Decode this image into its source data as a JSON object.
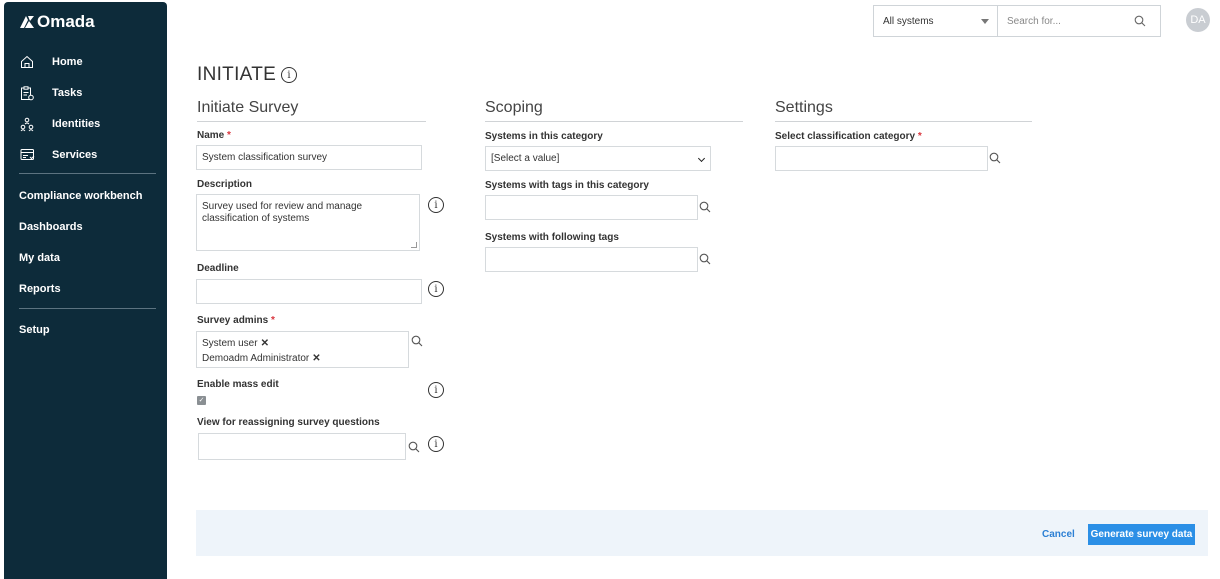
{
  "app": {
    "logo_text": "Omada"
  },
  "sidebar": {
    "items": [
      {
        "label": "Home",
        "icon": "home-icon"
      },
      {
        "label": "Tasks",
        "icon": "tasks-icon"
      },
      {
        "label": "Identities",
        "icon": "identities-icon"
      },
      {
        "label": "Services",
        "icon": "services-icon"
      }
    ],
    "links": [
      "Compliance workbench",
      "Dashboards",
      "My data",
      "Reports"
    ],
    "setup": "Setup"
  },
  "topbar": {
    "system_filter": "All systems",
    "search_placeholder": "Search for...",
    "avatar_initials": "DA"
  },
  "page": {
    "title": "INITIATE"
  },
  "initiate": {
    "heading": "Initiate Survey",
    "name_label": "Name",
    "name_value": "System classification survey",
    "description_label": "Description",
    "description_value": "Survey used for review and manage classification of systems",
    "deadline_label": "Deadline",
    "deadline_value": "",
    "admins_label": "Survey admins",
    "admins": [
      "System user",
      "Demoadm Administrator"
    ],
    "mass_edit_label": "Enable mass edit",
    "mass_edit_checked": true,
    "reassign_label": "View for reassigning survey questions",
    "reassign_value": ""
  },
  "scoping": {
    "heading": "Scoping",
    "category_label": "Systems in this category",
    "category_value": "[Select a value]",
    "tags_category_label": "Systems with tags in this category",
    "tags_label": "Systems with following tags"
  },
  "settings": {
    "heading": "Settings",
    "classification_label": "Select classification category"
  },
  "footer": {
    "cancel": "Cancel",
    "generate": "Generate survey data"
  },
  "colors": {
    "sidebar": "#0d2b3a",
    "primary": "#2b8fe6",
    "required": "#d9363e",
    "footer_bg": "#eef4fa"
  }
}
